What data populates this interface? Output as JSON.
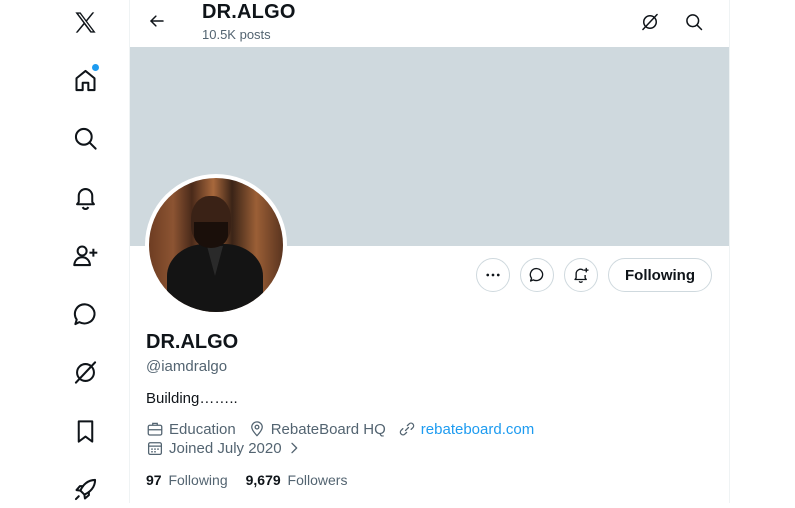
{
  "nav": {
    "items": [
      {
        "name": "x-logo-icon"
      },
      {
        "name": "home-icon",
        "has_dot": true,
        "dot_color": "#1d9bf0"
      },
      {
        "name": "search-icon"
      },
      {
        "name": "notifications-bell-icon"
      },
      {
        "name": "follow-people-icon"
      },
      {
        "name": "chat-bubble-icon"
      },
      {
        "name": "premium-slash-icon"
      },
      {
        "name": "bookmark-icon"
      },
      {
        "name": "rocket-icon"
      }
    ]
  },
  "header": {
    "title": "DR.ALGO",
    "posts_count": "10.5K posts",
    "icons": [
      "premium-slash-icon",
      "search-icon"
    ]
  },
  "banner": {
    "color": "#cfd9de"
  },
  "profile": {
    "display_name": "DR.ALGO",
    "handle": "@iamdralgo",
    "bio": "Building……..",
    "category": "Education",
    "location": "RebateBoard HQ",
    "website": "rebateboard.com",
    "joined": "Joined July 2020",
    "following_count": "97",
    "following_label": "Following",
    "followers_count": "9,679",
    "followers_label": "Followers"
  },
  "actions": {
    "more_icon": "more-horizontal-icon",
    "message_icon": "message-bubble-icon",
    "notify_icon": "bell-plus-icon",
    "follow_label": "Following"
  },
  "colors": {
    "accent": "#1d9bf0",
    "text_primary": "#0f1419",
    "text_secondary": "#536471",
    "border": "#cfd9de"
  }
}
